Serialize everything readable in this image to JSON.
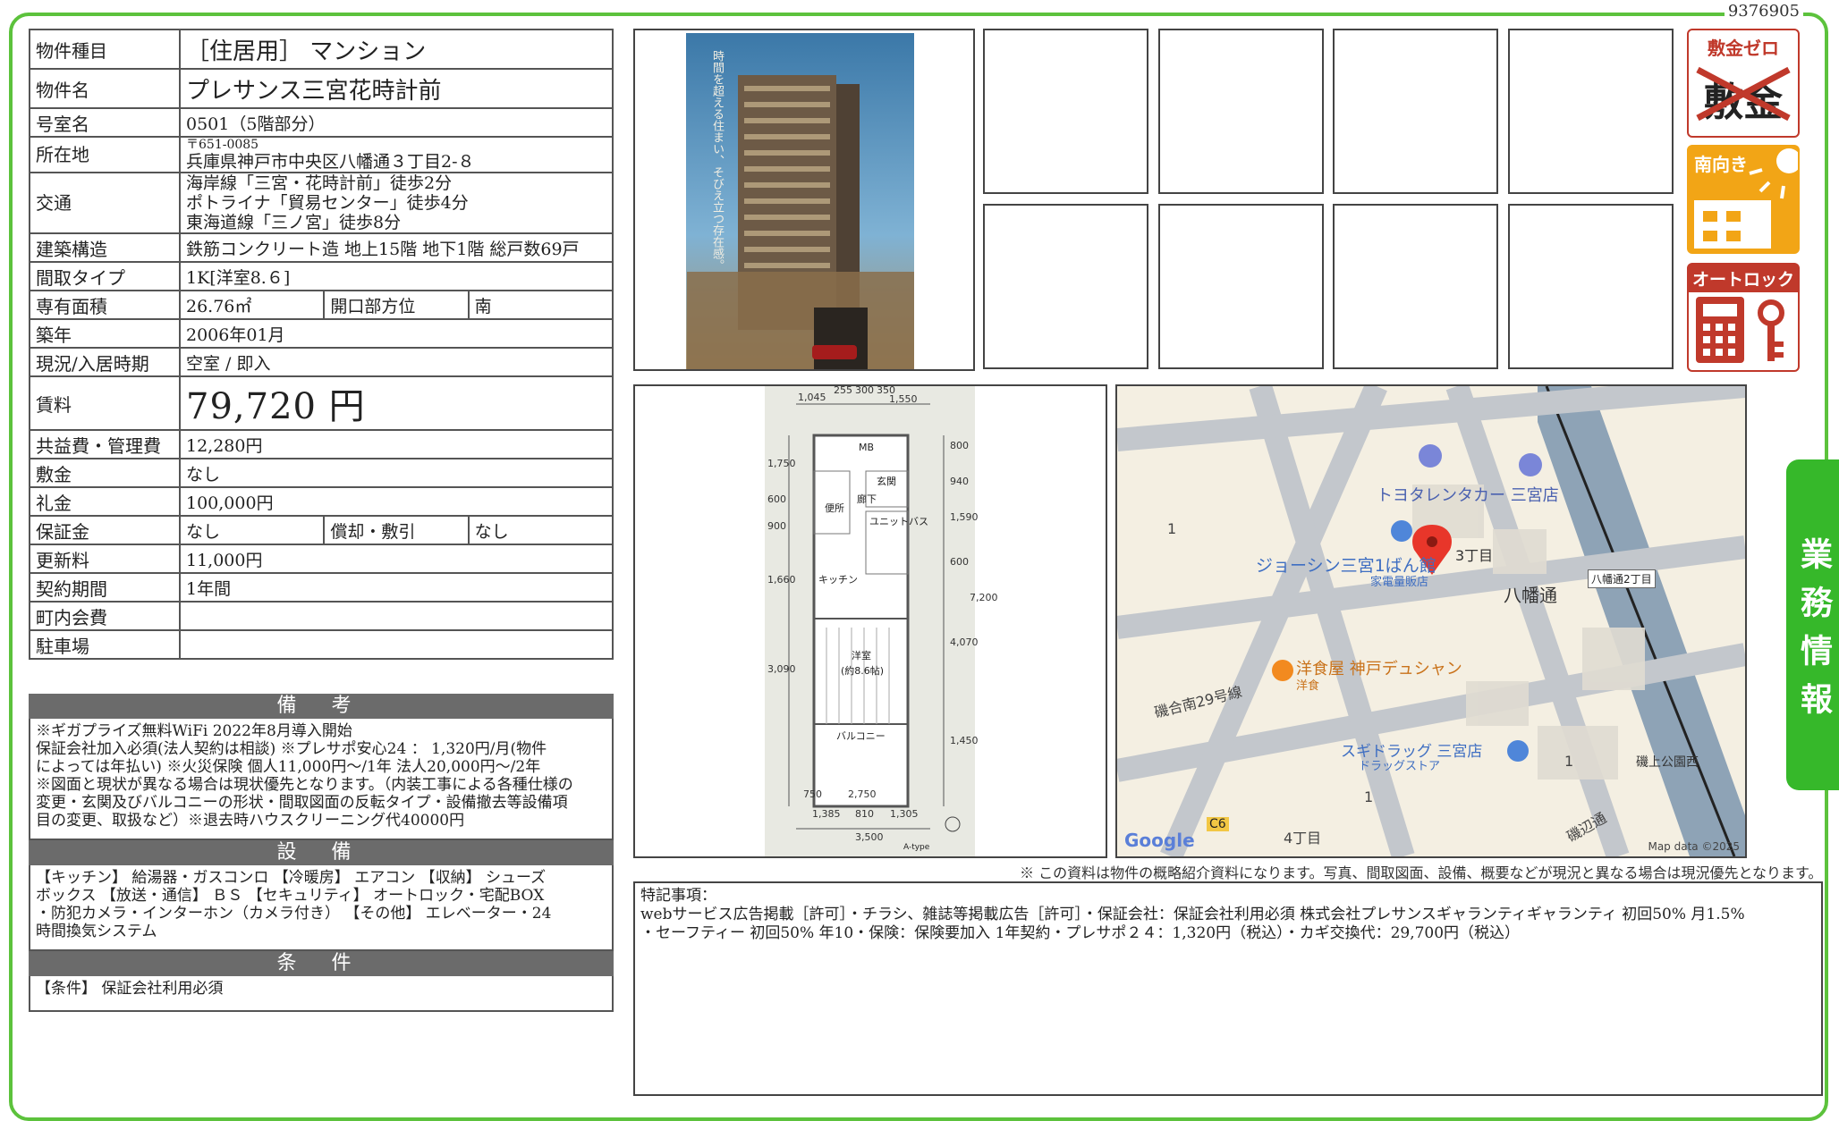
{
  "doc_id": "9376905",
  "property": {
    "rows": {
      "type": {
        "label": "物件種目",
        "value": "［住居用］ マンション"
      },
      "name": {
        "label": "物件名",
        "value": "プレサンス三宮花時計前"
      },
      "room": {
        "label": "号室名",
        "value": "0501（5階部分）"
      },
      "address": {
        "label": "所在地",
        "postal": "〒651-0085",
        "value": "兵庫県神戸市中央区八幡通３丁目2-８"
      },
      "transport": {
        "label": "交通",
        "lines": [
          "海岸線「三宮・花時計前」徒歩2分",
          "ポトライナ「貿易センター」徒歩4分",
          "東海道線「三ノ宮」徒歩8分"
        ]
      },
      "structure": {
        "label": "建築構造",
        "value": "鉄筋コンクリート造 地上15階 地下1階 総戸数69戸"
      },
      "layout": {
        "label": "間取タイプ",
        "value": "1K[洋室8.６]"
      },
      "area": {
        "label": "専有面積",
        "value": "26.76㎡",
        "sub_label": "開口部方位",
        "sub_value": "南"
      },
      "built": {
        "label": "築年",
        "value": "2006年01月"
      },
      "status": {
        "label": "現況/入居時期",
        "value": "空室 / 即入"
      },
      "rent": {
        "label": "賃料",
        "value": "79,720 円"
      },
      "fee": {
        "label": "共益費・管理費",
        "value": "12,280円"
      },
      "deposit": {
        "label": "敷金",
        "value": "なし"
      },
      "key_money": {
        "label": "礼金",
        "value": "100,000円"
      },
      "guarantee": {
        "label": "保証金",
        "value": "なし",
        "sub_label": "償却・敷引",
        "sub_value": "なし"
      },
      "renewal": {
        "label": "更新料",
        "value": "11,000円"
      },
      "contract": {
        "label": "契約期間",
        "value": "1年間"
      },
      "town": {
        "label": "町内会費",
        "value": ""
      },
      "parking": {
        "label": "駐車場",
        "value": ""
      }
    }
  },
  "remarks": {
    "title": "備 考",
    "lines": [
      "※ギガプライズ無料WiFi 2022年8月導入開始",
      "保証会社加入必須(法人契約は相談) ※プレサポ安心24 ： 1,320円/月(物件",
      "によっては年払い) ※火災保険 個人11,000円～/1年 法人20,000円～/2年",
      "※図面と現状が異なる場合は現状優先となります。（内装工事による各種仕様の",
      "変更・玄関及びバルコニーの形状・間取図面の反転タイプ・設備撤去等設備項",
      "目の変更、取扱など）※退去時ハウスクリーニング代40000円"
    ]
  },
  "facilities": {
    "title": "設 備",
    "lines": [
      "【キッチン】 給湯器・ガスコンロ 【冷暖房】 エアコン 【収納】 シューズ",
      "ボックス 【放送・通信】 ＢＳ 【セキュリティ】 オートロック・宅配BOX",
      "・防犯カメラ・インターホン（カメラ付き） 【その他】 エレベーター・24",
      "時間換気システム"
    ]
  },
  "conditions": {
    "title": "条 件",
    "lines": [
      "【条件】 保証会社利用必須"
    ]
  },
  "building_caption": "時間を超える住まい、そびえ立つ存在感。",
  "badges": [
    {
      "title": "敷金ゼロ",
      "mark": "敷金"
    },
    {
      "title": "南向き"
    },
    {
      "title": "オートロック"
    }
  ],
  "side_tab": "業務情報",
  "floorplan": {
    "dims_top": [
      "1,045",
      "255",
      "300",
      "350",
      "1,550"
    ],
    "dims_right": [
      "800",
      "940",
      "1,590",
      "600",
      "4,070",
      "1,450",
      "7,200"
    ],
    "dims_left": [
      "1,750",
      "600",
      "900",
      "1,660",
      "3,090"
    ],
    "dims_bottom": [
      "750",
      "2,750",
      "1,385",
      "810",
      "1,305",
      "3,500"
    ],
    "rooms": [
      "MB",
      "玄関",
      "廊下",
      "便所",
      "ユニットバス",
      "キッチン",
      "洋室",
      "(約8.6帖)",
      "バルコニー"
    ],
    "type_label": "A-type"
  },
  "map": {
    "labels": [
      "トヨタレンタカー 三宮店",
      "ジョーシン三宮1ばん館",
      "家電量販店",
      "3丁目",
      "八幡通",
      "八幡通2丁目",
      "洋食屋 神戸デュシャン",
      "洋食",
      "磯合南29号線",
      "スギドラッグ 三宮店",
      "ドラッグストア",
      "磯上公園西",
      "1",
      "1",
      "1",
      "4丁目",
      "C6",
      "磯辺通",
      "Google",
      "Map data ©2025"
    ]
  },
  "disclaimer": "※ この資料は物件の概略紹介資料になります。写真、間取図面、設備、概要などが現況と異なる場合は現況優先となります。",
  "notes": {
    "title": "特記事項：",
    "lines": [
      "webサービス広告掲載［許可］・チラシ、雑誌等掲載広告［許可］・保証会社：保証会社利用必須 株式会社プレサンスギャランティギャランティ 初回50% 月1.5%",
      "・セーフティー 初回50% 年10・保険：保険要加入 1年契約・プレサポ２４：1,320円（税込）・カギ交換代：29,700円（税込）"
    ]
  },
  "colors": {
    "frame": "#5cc23c",
    "header": "#6b6b6b",
    "badge": "#c0392b",
    "badge_orange": "#f2a516",
    "tab": "#36b82a",
    "map_bg": "#f4efe2",
    "pin": "#e8362a"
  }
}
